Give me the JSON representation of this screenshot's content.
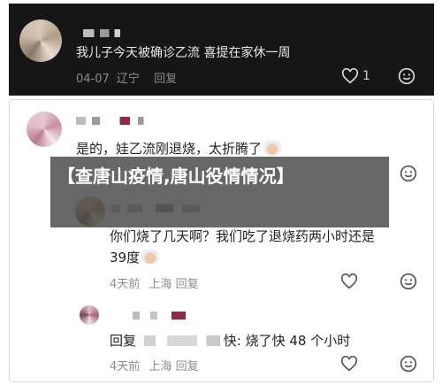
{
  "top_comment": {
    "text": "我儿子今天被确诊乙流 喜提在家休一周",
    "date": "04-07",
    "location": "辽宁",
    "reply_label": "回复",
    "like_count": "1"
  },
  "comments": [
    {
      "text": "是的，娃乙流刚退烧，太折腾了"
    },
    {
      "text_line1": "你们烧了几天啊？我们吃了退烧药两小时还是",
      "text_line2": "39度",
      "time": "4天前",
      "location": "上海",
      "reply_label": "回复"
    },
    {
      "text_prefix": "回复",
      "text_suffix": "快: 烧了快 48 个小时",
      "time": "4天前",
      "location": "上海",
      "reply_label": "回复"
    }
  ],
  "banner": {
    "text": "【查唐山疫情,唐山役情情况】"
  },
  "icons": [
    "heart-icon",
    "smiley-icon",
    "sticker-emoji"
  ]
}
